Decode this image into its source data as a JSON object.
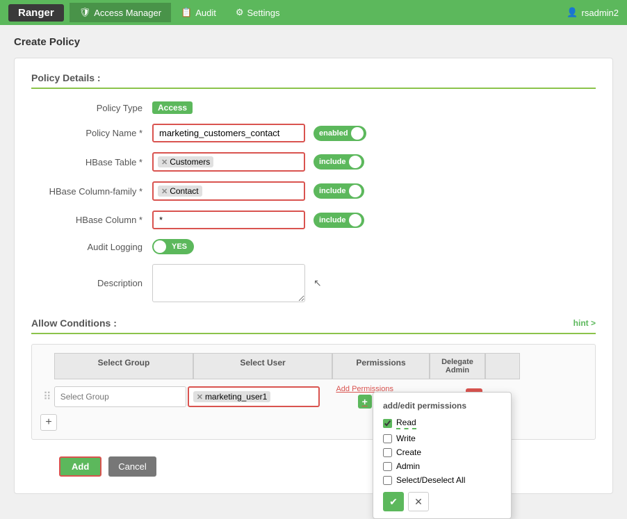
{
  "nav": {
    "brand": "Ranger",
    "items": [
      {
        "id": "access-manager",
        "label": "Access Manager",
        "icon": "shield-icon",
        "active": true
      },
      {
        "id": "audit",
        "label": "Audit",
        "icon": "audit-icon",
        "active": false
      },
      {
        "id": "settings",
        "label": "Settings",
        "icon": "gear-icon",
        "active": false
      }
    ],
    "user": "rsadmin2"
  },
  "page": {
    "title": "Create Policy"
  },
  "policy_details": {
    "section_label": "Policy Details :",
    "policy_type_label": "Policy Type",
    "policy_type_value": "Access",
    "policy_name_label": "Policy Name *",
    "policy_name_value": "marketing_customers_contact",
    "policy_name_placeholder": "",
    "enabled_label": "enabled",
    "hbase_table_label": "HBase Table *",
    "hbase_table_tag": "Customers",
    "include_label_1": "include",
    "hbase_column_family_label": "HBase Column-family *",
    "hbase_column_family_tag": "Contact",
    "include_label_2": "include",
    "hbase_column_label": "HBase Column *",
    "hbase_column_value": "*",
    "include_label_3": "include",
    "audit_logging_label": "Audit Logging",
    "audit_yes": "YES",
    "description_label": "Description"
  },
  "allow_conditions": {
    "section_label": "Allow Conditions :",
    "hint_label": "hint >",
    "col_headers": [
      "Select Group",
      "Select User",
      "Permissions",
      "Delegate Admin",
      ""
    ],
    "row": {
      "select_group_placeholder": "Select Group",
      "select_user_tag": "marketing_user1",
      "add_perms_label": "Add Permissions",
      "add_perms_plus": "+"
    },
    "add_row_btn": "+"
  },
  "permissions_popup": {
    "title": "add/edit permissions",
    "options": [
      {
        "id": "read",
        "label": "Read",
        "checked": true
      },
      {
        "id": "write",
        "label": "Write",
        "checked": false
      },
      {
        "id": "create",
        "label": "Create",
        "checked": false
      },
      {
        "id": "admin",
        "label": "Admin",
        "checked": false
      },
      {
        "id": "select_deselect_all",
        "label": "Select/Deselect All",
        "checked": false
      }
    ],
    "ok_icon": "✔",
    "cancel_icon": "✕"
  },
  "footer": {
    "add_label": "Add",
    "cancel_label": "Cancel"
  }
}
